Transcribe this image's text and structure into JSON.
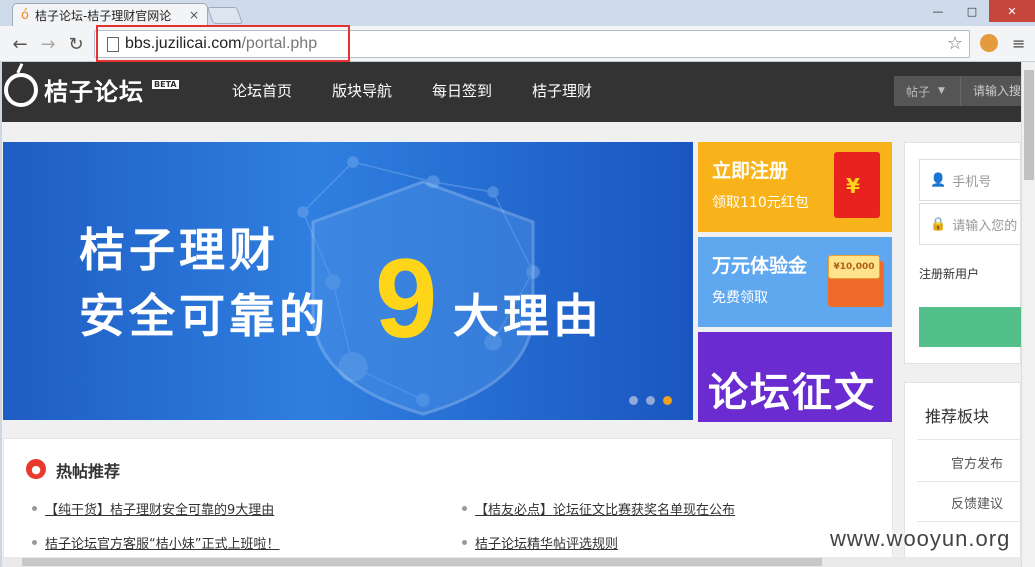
{
  "browser": {
    "tab_title": "桔子论坛-桔子理财官网论",
    "tab_close": "×",
    "url_host": "bbs.juzilicai.com",
    "url_path": "/portal.php",
    "win_minimize": "—",
    "win_maximize": "□",
    "win_close": "✕"
  },
  "header": {
    "logo_text": "桔子论坛",
    "beta": "BETA",
    "nav": [
      "论坛首页",
      "版块导航",
      "每日签到",
      "桔子理财"
    ],
    "search_scope": "帖子",
    "search_placeholder": "请输入搜"
  },
  "banner": {
    "line1": "桔子理财",
    "line2_prefix": "安全可靠的",
    "number": "9",
    "line2_suffix": "大理由",
    "slide_count": 3,
    "active_slide": 3
  },
  "promos": {
    "p1_title": "立即注册",
    "p1_sub": "领取110元红包",
    "p1_symbol": "¥",
    "p2_title": "万元体验金",
    "p2_sub": "免费领取",
    "p2_coupon": "¥10,000",
    "p3_title": "论坛征文"
  },
  "login": {
    "phone_placeholder": "手机号",
    "password_placeholder": "请输入您的",
    "register_link": "注册新用户"
  },
  "hot": {
    "title": "热帖推荐",
    "items": [
      "【纯干货】桔子理财安全可靠的9大理由",
      "【桔友必点】论坛征文比赛获奖名单现在公布",
      "桔子论坛官方客服“桔小妹”正式上班啦！",
      "桔子论坛精华帖评选规则"
    ]
  },
  "recommend": {
    "title": "推荐板块",
    "items": [
      "官方发布",
      "反馈建议"
    ]
  },
  "watermark": "www.wooyun.org",
  "colors": {
    "header_bg": "#333333",
    "banner_blue": "#2f7fe0",
    "banner_accent": "#ffd51a",
    "promo_orange": "#f8b31a",
    "promo_blue": "#5fa8f0",
    "promo_purple": "#6a2bd0",
    "login_green": "#53c08c",
    "highlight_red": "#e63232"
  }
}
